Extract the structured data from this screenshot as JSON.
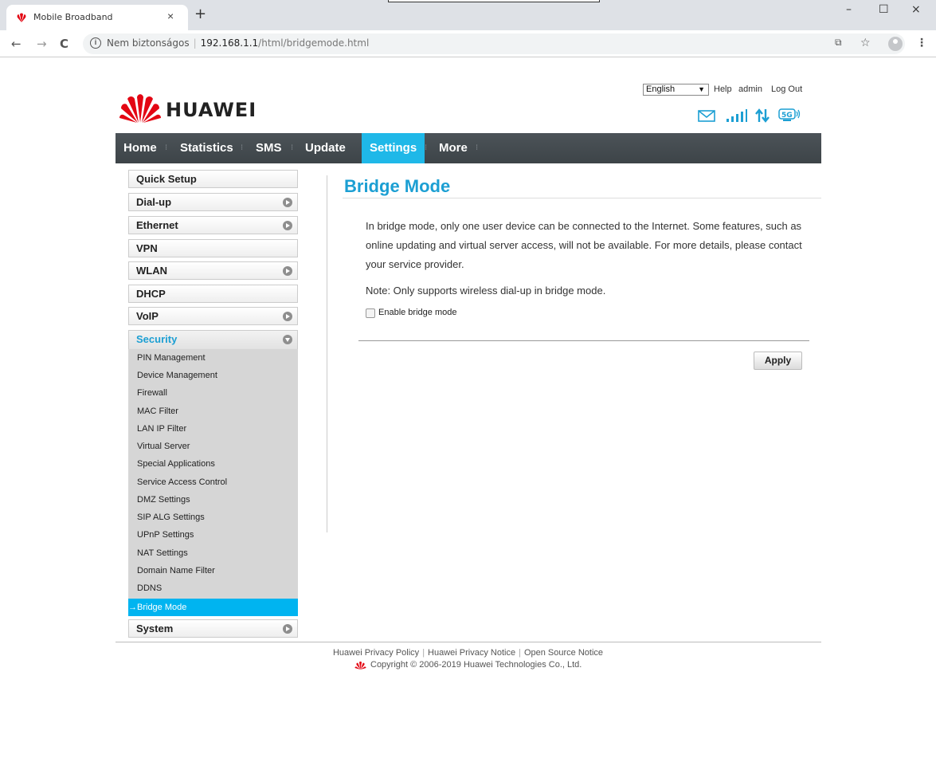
{
  "browser": {
    "tab_title": "Mobile Broadband",
    "tab_close": "×",
    "new_tab": "+",
    "window_controls": {
      "minimize": "–",
      "maximize": "☐",
      "close": "×"
    },
    "nav": {
      "back": "←",
      "forward": "→",
      "reload": "C"
    },
    "security_label": "Nem biztonságos",
    "url_host": "192.168.1.1",
    "url_path": "/html/bridgemode.html",
    "toolbar_icons": [
      "translate-icon",
      "star-icon",
      "profile-icon",
      "menu-icon"
    ]
  },
  "header": {
    "brand": "HUAWEI",
    "language": "English",
    "links": {
      "help": "Help",
      "user": "admin",
      "logout": "Log Out"
    },
    "status_icons": [
      "mail-icon",
      "signal-icon",
      "data-arrows-icon",
      "5g-icon"
    ]
  },
  "mainnav": {
    "items": [
      "Home",
      "Statistics",
      "SMS",
      "Update",
      "Settings",
      "More"
    ],
    "active": "Settings"
  },
  "sidebar": {
    "items": [
      {
        "label": "Quick Setup",
        "expandable": false
      },
      {
        "label": "Dial-up",
        "expandable": true
      },
      {
        "label": "Ethernet",
        "expandable": true
      },
      {
        "label": "VPN",
        "expandable": false
      },
      {
        "label": "WLAN",
        "expandable": true
      },
      {
        "label": "DHCP",
        "expandable": false
      },
      {
        "label": "VoIP",
        "expandable": true
      },
      {
        "label": "Security",
        "expandable": true,
        "open": true
      },
      {
        "label": "System",
        "expandable": true
      }
    ],
    "security_subitems": [
      "PIN Management",
      "Device Management",
      "Firewall",
      "MAC Filter",
      "LAN IP Filter",
      "Virtual Server",
      "Special Applications",
      "Service Access Control",
      "DMZ Settings",
      "SIP ALG Settings",
      "UPnP Settings",
      "NAT Settings",
      "Domain Name Filter",
      "DDNS",
      "Bridge Mode"
    ],
    "active_subitem": "Bridge Mode"
  },
  "content": {
    "title": "Bridge Mode",
    "description": "In bridge mode, only one user device can be connected to the Internet. Some features, such as online updating and virtual server access, will not be available. For more details, please contact your service provider.",
    "note": "Note: Only supports wireless dial-up in bridge mode.",
    "checkbox_label": "Enable bridge mode",
    "checkbox_checked": false,
    "apply_label": "Apply"
  },
  "footer": {
    "links": [
      "Huawei Privacy Policy",
      "Huawei Privacy Notice",
      "Open Source Notice"
    ],
    "copyright": "Copyright © 2006-2019 Huawei Technologies Co., Ltd."
  },
  "colors": {
    "accent": "#1c9fd3",
    "nav_active": "#1fb8e8",
    "nav_bg": "#454c51",
    "active_subitem": "#00b4f0",
    "brand_red": "#e30613"
  }
}
